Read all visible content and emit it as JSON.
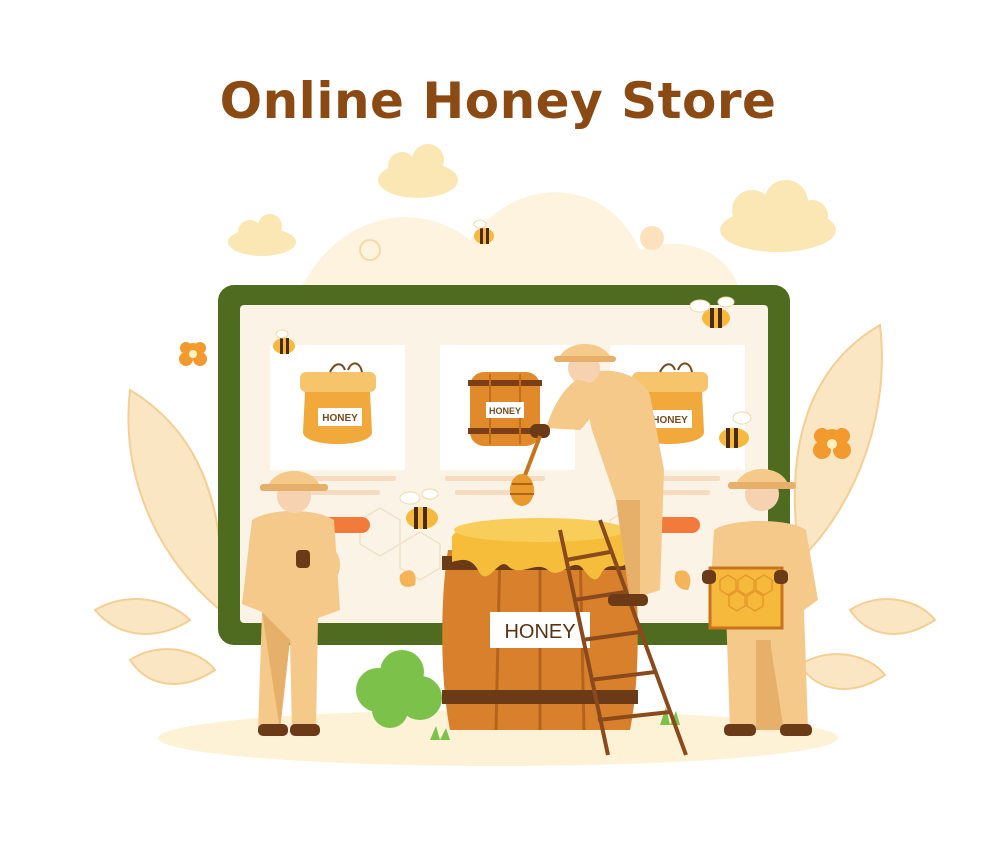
{
  "title": "Online Honey Store",
  "product_cards": [
    {
      "label": "HONEY"
    },
    {
      "label": "HONEY"
    },
    {
      "label": "HONEY"
    }
  ],
  "barrel_label": "HONEY",
  "colors": {
    "title": "#8b4a14",
    "monitor_frame": "#4f6b1f",
    "screen": "#fbf3e6",
    "honey": "#f2a93b",
    "honey_dark": "#c9741d",
    "wood": "#d9802c",
    "wood_band": "#6b3b17",
    "suit": "#f4c98a",
    "suit_shade": "#e6b06b",
    "cloud": "#fbe7b4",
    "leaf": "#f7d9a6",
    "flower": "#f29a2e",
    "bush": "#7cc24a",
    "button": "#f27a3b"
  },
  "icons": [
    "bee-icon",
    "flower-icon",
    "cloud-icon",
    "honey-jar-icon",
    "honey-barrel-icon",
    "honeycomb-frame-icon",
    "honey-dipper-icon",
    "ladder-icon",
    "leaf-icon"
  ]
}
